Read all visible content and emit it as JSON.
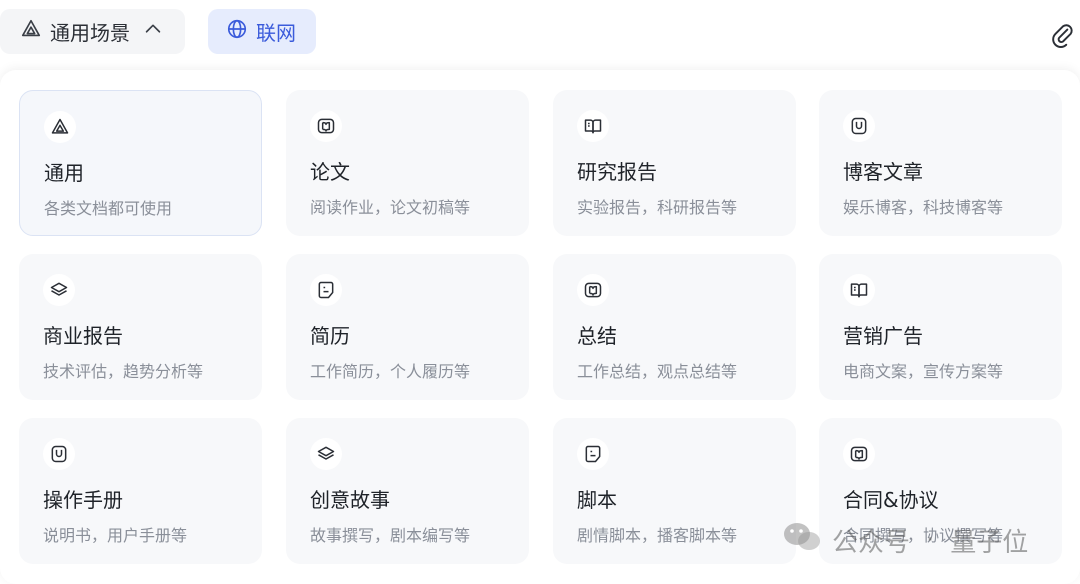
{
  "toolbar": {
    "scene_label": "通用场景",
    "network_label": "联网"
  },
  "cards": [
    {
      "title": "通用",
      "desc": "各类文档都可使用",
      "icon": "triangle-icon"
    },
    {
      "title": "论文",
      "desc": "阅读作业，论文初稿等",
      "icon": "book-icon"
    },
    {
      "title": "研究报告",
      "desc": "实验报告，科研报告等",
      "icon": "open-book-icon"
    },
    {
      "title": "博客文章",
      "desc": "娱乐博客，科技博客等",
      "icon": "document-icon"
    },
    {
      "title": "商业报告",
      "desc": "技术评估，趋势分析等",
      "icon": "layers-icon"
    },
    {
      "title": "简历",
      "desc": "工作简历，个人履历等",
      "icon": "note-icon"
    },
    {
      "title": "总结",
      "desc": "工作总结，观点总结等",
      "icon": "book-icon"
    },
    {
      "title": "营销广告",
      "desc": "电商文案，宣传方案等",
      "icon": "open-book-icon"
    },
    {
      "title": "操作手册",
      "desc": "说明书，用户手册等",
      "icon": "document-icon"
    },
    {
      "title": "创意故事",
      "desc": "故事撰写，剧本编写等",
      "icon": "layers-icon"
    },
    {
      "title": "脚本",
      "desc": "剧情脚本，播客脚本等",
      "icon": "note-icon"
    },
    {
      "title": "合同&协议",
      "desc": "合同撰写，协议撰写等",
      "icon": "book-icon"
    }
  ],
  "watermark": {
    "left": "公众号",
    "right": "量子位"
  },
  "colors": {
    "accent": "#3b5bdb",
    "card_bg": "#f7f8fa",
    "network_bg": "#e6ecfd"
  }
}
